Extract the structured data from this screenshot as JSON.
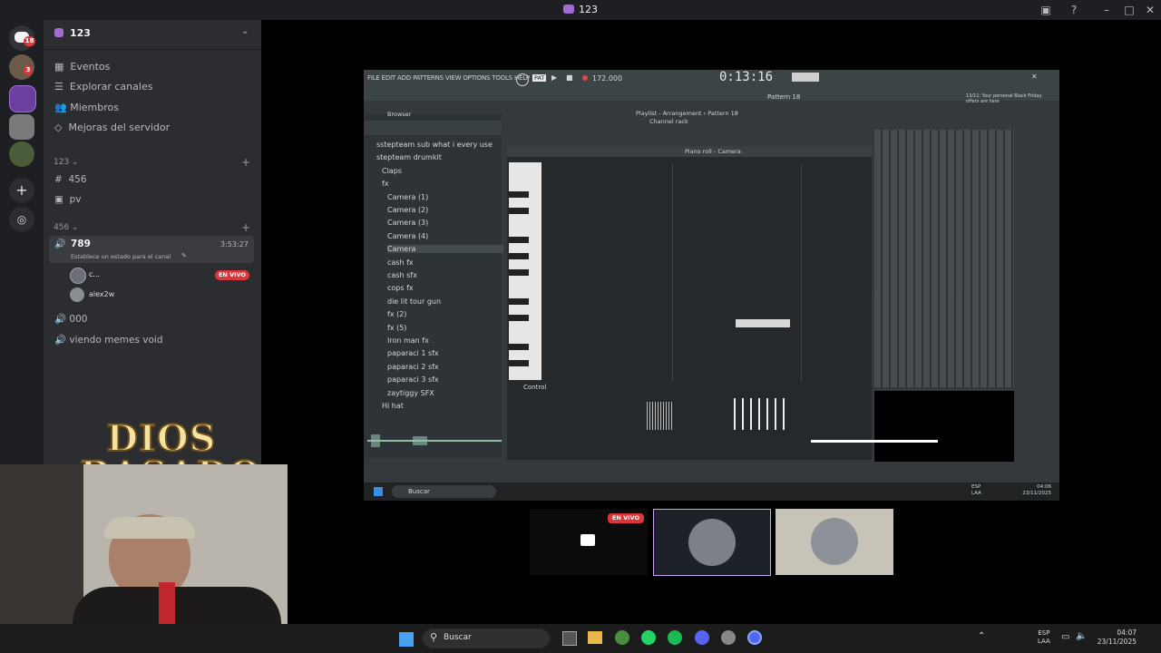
{
  "window": {
    "title": "123"
  },
  "server": {
    "name": "123"
  },
  "rail_badges": [
    "18",
    "3"
  ],
  "menu": {
    "events": "Eventos",
    "explore": "Explorar canales",
    "members": "Miembros",
    "boosts": "Mejoras del servidor"
  },
  "categories": {
    "cat1": "123",
    "cat2": "456"
  },
  "channels": {
    "text1": "456",
    "text2": "pv",
    "voice_active": {
      "name": "789",
      "timer": "3:53:27",
      "status_hint": "Establece un estado para el canal"
    },
    "voice_users": [
      {
        "name": "c...",
        "live": "EN VIVO"
      },
      {
        "name": "alex2w"
      }
    ],
    "voice2": "000",
    "voice3": "viendo memes void"
  },
  "overlay": {
    "line1": "DIOS",
    "line2": "BASADO"
  },
  "stream_tiles": {
    "live_badge": "EN VIVO"
  },
  "fl": {
    "menu": [
      "FILE",
      "EDIT",
      "ADD",
      "PATTERNS",
      "VIEW",
      "OPTIONS",
      "TOOLS",
      "HELP"
    ],
    "time": "0:13:16",
    "tempo": "172.000",
    "pattern": "Pattern 18",
    "piano_roll_title": "Piano roll - Camera",
    "channel_rack": "Channel rack",
    "playlist": "Playlist - Arrangement › Pattern 18",
    "control": "Control",
    "news": "13/11: Your personal Black Friday offers are here",
    "browser_items": [
      "sstepteam sub what i every use",
      "stepteam drumkit",
      "Claps",
      "fx",
      "Camera (1)",
      "Camera (2)",
      "Camera (3)",
      "Camera (4)",
      "Camera",
      "cash fx",
      "cash sfx",
      "cops fx",
      "die lit tour gun",
      "fx (2)",
      "fx (5)",
      "Iron man fx",
      "paparaci 1 sfx",
      "paparaci 2 sfx",
      "paparaci 3 sfx",
      "zaytiggy SFX",
      "Hi hat"
    ],
    "inner_search": "Buscar",
    "inner_lang": "ESP\nLAA",
    "inner_clock": "04:06",
    "inner_date": "23/11/2025"
  },
  "taskbar": {
    "search": "Buscar",
    "lang1": "ESP",
    "lang2": "LAA",
    "time": "04:07",
    "date": "23/11/2025"
  }
}
